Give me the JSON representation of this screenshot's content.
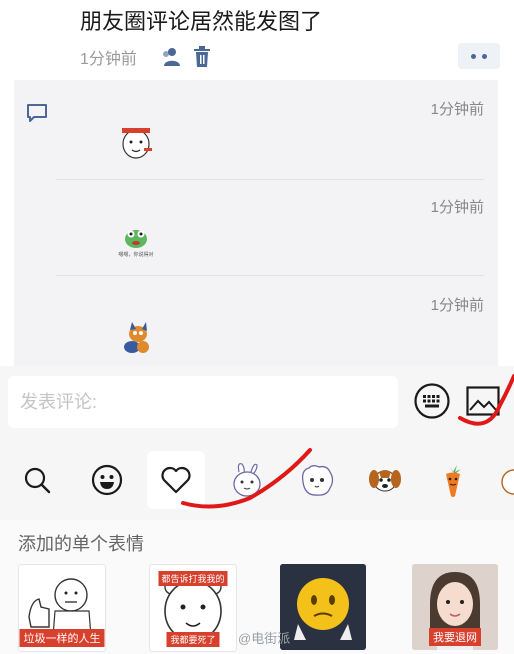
{
  "post": {
    "title": "朋友圈评论居然能发图了",
    "time": "1分钟前"
  },
  "comments": [
    {
      "time": "1分钟前",
      "sticker": "bear-face-sticker"
    },
    {
      "time": "1分钟前",
      "sticker": "green-frog-sticker",
      "caption": "嗯嗯，你说得对"
    },
    {
      "time": "1分钟前",
      "sticker": "fox-sticker"
    }
  ],
  "composer": {
    "placeholder": "发表评论:"
  },
  "emoji_tabs": [
    {
      "icon": "search-icon"
    },
    {
      "icon": "smiley-icon"
    },
    {
      "icon": "heart-icon",
      "selected": true
    },
    {
      "icon": "bunny-sticker-tab"
    },
    {
      "icon": "fluffy-cat-sticker-tab"
    },
    {
      "icon": "dog-sticker-tab"
    },
    {
      "icon": "carrot-sticker-tab"
    }
  ],
  "stickers_panel": {
    "title": "添加的单个表情",
    "items": [
      {
        "caption": "垃圾一样的人生"
      },
      {
        "top_caption": "都告诉打我我的",
        "caption": "我都要死了"
      },
      {
        "caption": ""
      },
      {
        "caption": "我要退网"
      }
    ]
  },
  "watermark": "@电街派",
  "colors": {
    "accent": "#4a6795",
    "annotation": "#e01818",
    "panel_bg": "#f3f3f5"
  }
}
